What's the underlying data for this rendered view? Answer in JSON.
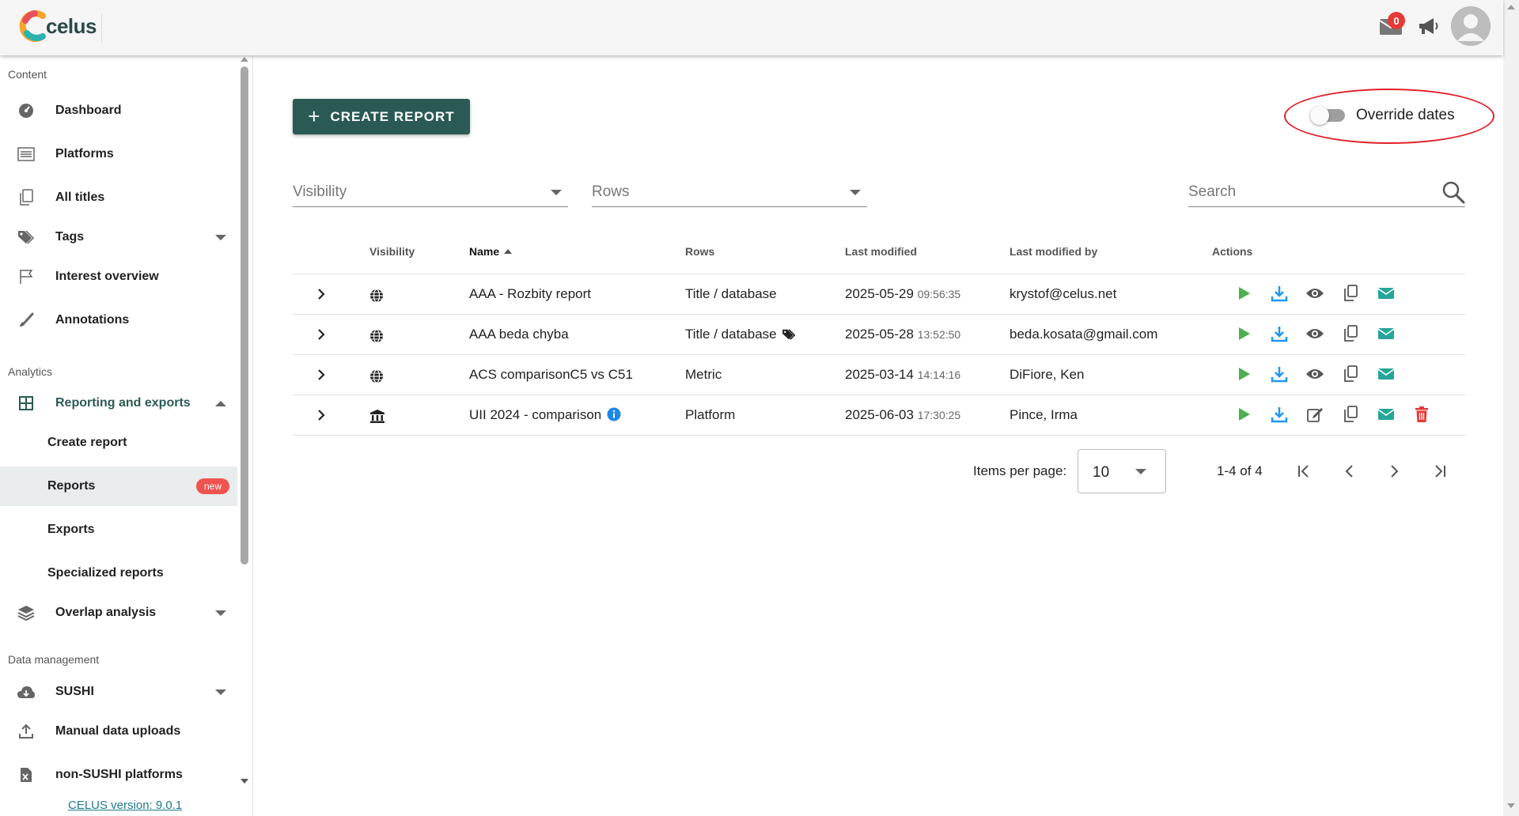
{
  "app": {
    "logo_text": "celus",
    "notification_count": "0"
  },
  "sidebar": {
    "sections": {
      "content": "Content",
      "analytics": "Analytics",
      "data_management": "Data management"
    },
    "items": {
      "dashboard": "Dashboard",
      "platforms": "Platforms",
      "all_titles": "All titles",
      "tags": "Tags",
      "interest_overview": "Interest overview",
      "annotations": "Annotations",
      "reporting_and_exports": "Reporting and exports",
      "create_report": "Create report",
      "reports": "Reports",
      "reports_badge": "new",
      "exports": "Exports",
      "specialized_reports": "Specialized reports",
      "overlap_analysis": "Overlap analysis",
      "sushi": "SUSHI",
      "manual_data_uploads": "Manual data uploads",
      "non_sushi_platforms": "non-SUSHI platforms"
    },
    "version": "CELUS version: 9.0.1"
  },
  "toolbar": {
    "create_report_label": "CREATE REPORT",
    "override_dates_label": "Override dates",
    "override_dates_on": false
  },
  "filters": {
    "visibility_label": "Visibility",
    "rows_label": "Rows",
    "search_placeholder": "Search"
  },
  "table": {
    "headers": {
      "visibility": "Visibility",
      "name": "Name",
      "rows": "Rows",
      "last_modified": "Last modified",
      "last_modified_by": "Last modified by",
      "actions": "Actions"
    },
    "rows": [
      {
        "visibility_icon": "globe-icon",
        "name": "AAA - Rozbity report",
        "rows": "Title / database",
        "date": "2025-05-29",
        "time": "09:56:35",
        "by": "krystof@celus.net"
      },
      {
        "visibility_icon": "globe-icon",
        "name": "AAA beda chyba",
        "rows": "Title / database",
        "date": "2025-05-28",
        "time": "13:52:50",
        "by": "beda.kosata@gmail.com"
      },
      {
        "visibility_icon": "globe-icon",
        "name": "ACS comparisonC5 vs C51",
        "rows": "Metric",
        "date": "2025-03-14",
        "time": "14:14:16",
        "by": "DiFiore, Ken"
      },
      {
        "visibility_icon": "institution-icon",
        "name": "UII 2024 - comparison",
        "rows": "Platform",
        "date": "2025-06-03",
        "time": "17:30:25",
        "by": "Pince, Irma"
      }
    ]
  },
  "pagination": {
    "items_per_page_label": "Items per page:",
    "items_per_page_value": "10",
    "range_text": "1-4 of 4"
  },
  "colors": {
    "primary": "#2b5a55",
    "play": "#4caf50",
    "download": "#2196f3",
    "email": "#26a69a",
    "delete": "#e53935",
    "highlight_ellipse": "#e0202a"
  }
}
